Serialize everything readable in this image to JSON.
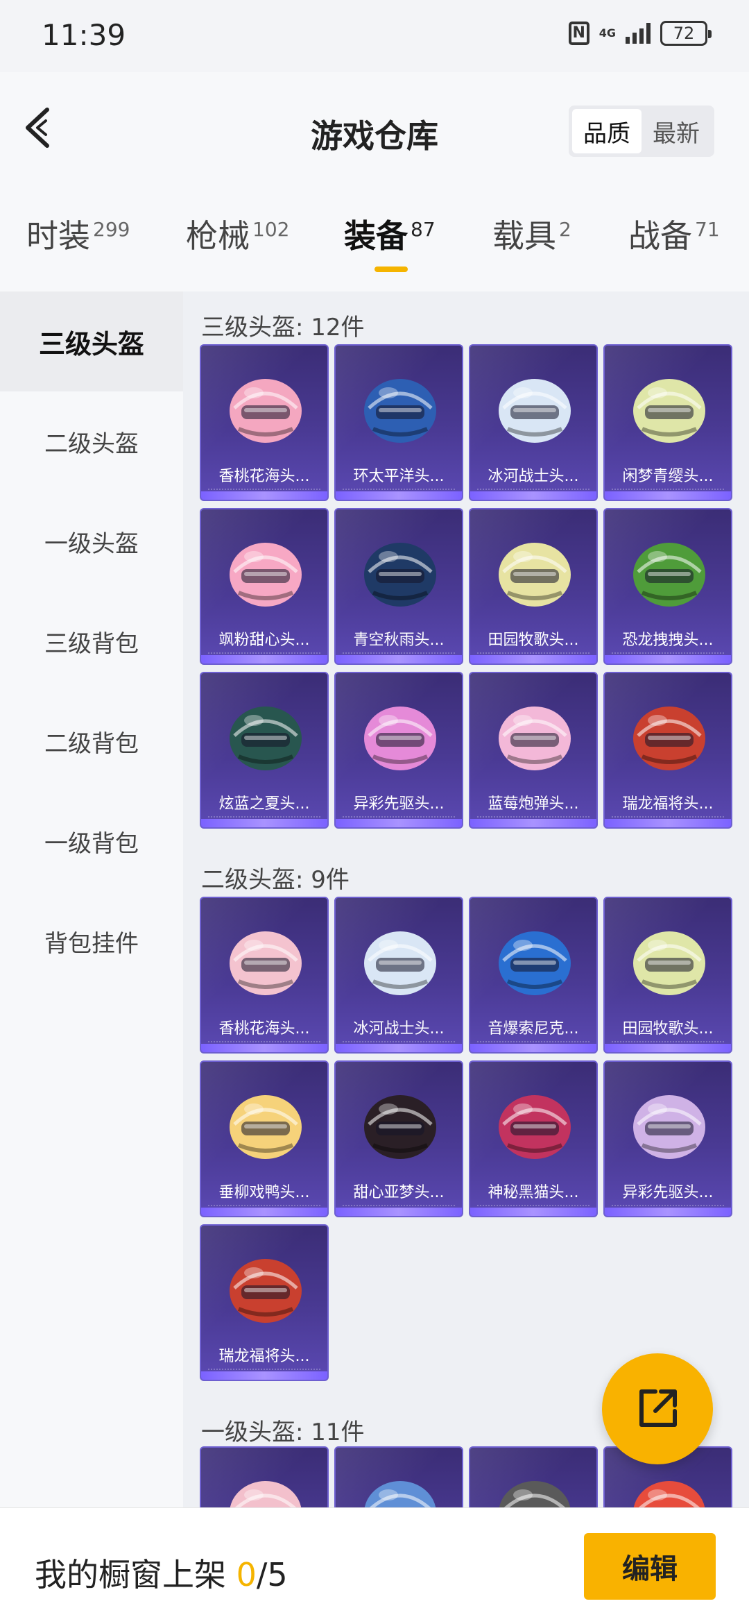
{
  "status": {
    "time": "11:39",
    "network": "4G",
    "battery": "72"
  },
  "header": {
    "title": "游戏仓库",
    "sort": [
      "品质",
      "最新"
    ]
  },
  "tabs": [
    {
      "label": "时装",
      "count": "299"
    },
    {
      "label": "枪械",
      "count": "102"
    },
    {
      "label": "装备",
      "count": "87"
    },
    {
      "label": "载具",
      "count": "2"
    },
    {
      "label": "战备",
      "count": "71"
    }
  ],
  "sidebar": [
    "三级头盔",
    "二级头盔",
    "一级头盔",
    "三级背包",
    "二级背包",
    "一级背包",
    "背包挂件"
  ],
  "sections": [
    {
      "title": "三级头盔: 12件",
      "items": [
        "香桃花海头...",
        "环太平洋头...",
        "冰河战士头...",
        "闲梦青缨头...",
        "飒粉甜心头...",
        "青空秋雨头...",
        "田园牧歌头...",
        "恐龙拽拽头...",
        "炫蓝之夏头...",
        "异彩先驱头...",
        "蓝莓炮弹头...",
        "瑞龙福将头..."
      ]
    },
    {
      "title": "二级头盔: 9件",
      "items": [
        "香桃花海头...",
        "冰河战士头...",
        "音爆索尼克...",
        "田园牧歌头...",
        "垂柳戏鸭头...",
        "甜心亚梦头...",
        "神秘黑猫头...",
        "异彩先驱头...",
        "瑞龙福将头..."
      ]
    },
    {
      "title": "一级头盔: 11件",
      "items": [
        "",
        "",
        "",
        ""
      ]
    }
  ],
  "colors": {
    "helmets1": [
      "#f4a7c0",
      "#2d5fb3",
      "#d9e6f5",
      "#dfe6a8",
      "#f7a8c4",
      "#1f3a66",
      "#e7e3a2",
      "#4f9c3a",
      "#28564f",
      "#e58ad8",
      "#f3b8d8",
      "#c9402f"
    ],
    "helmets2": [
      "#f4c3cf",
      "#d9e6f5",
      "#2a6fd1",
      "#dfe6a8",
      "#f6d27a",
      "#2a1f26",
      "#c2335f",
      "#cfb2e6",
      "#c9402f"
    ],
    "helmets3": [
      "#f3c0cc",
      "#5f8fd6",
      "#5a5a5a",
      "#e74c3c"
    ],
    "accent": "#f9b200"
  },
  "fab": {
    "icon": "share-icon"
  },
  "bottom": {
    "label": "我的橱窗上架",
    "count": "0",
    "total": "/5",
    "edit": "编辑"
  }
}
